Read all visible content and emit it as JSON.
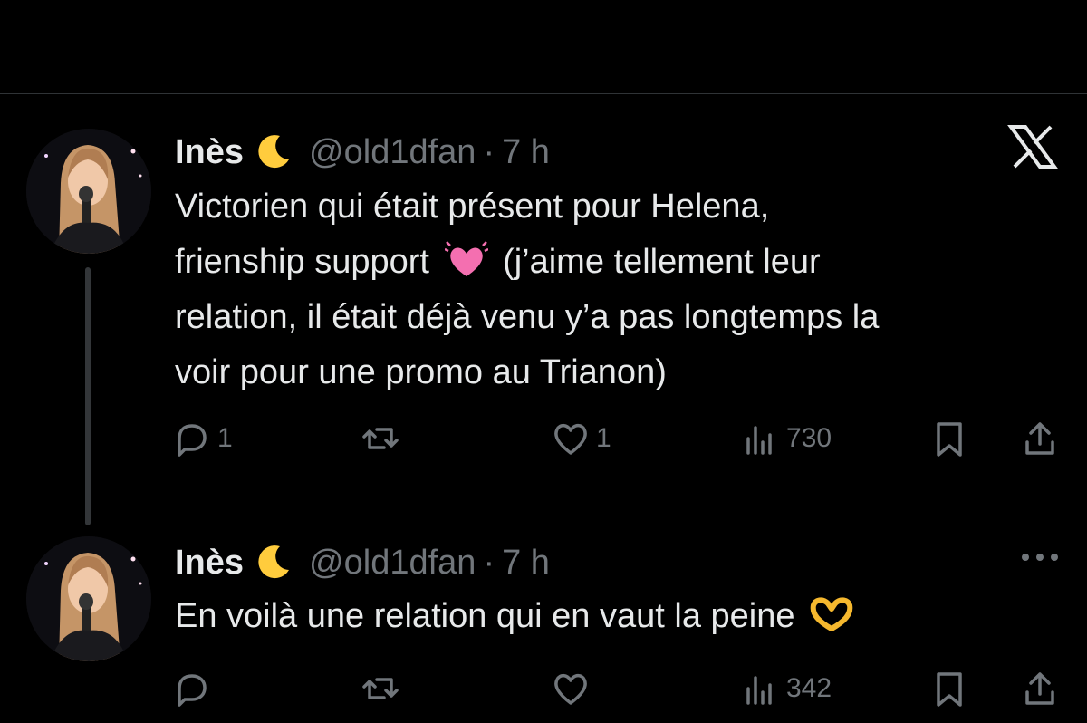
{
  "tweets": [
    {
      "name": "Inès",
      "name_emoji": "moon-emoji",
      "handle": "@old1dfan",
      "separator": "·",
      "time": "7 h",
      "text_lines": [
        "Victorien qui était présent pour Helena,",
        [
          "friendship_pre",
          "friendship_post"
        ],
        "relation, il était déjà venu y’a pas longtemps la",
        "voir pour une promo au Trianon)"
      ],
      "line1": "Victorien qui était présent pour Helena,",
      "line2_pre": "frienship support",
      "line2_post": "(j’aime tellement leur",
      "line3": "relation, il était déjà venu y’a pas longtemps la",
      "line4": "voir pour une promo au Trianon)",
      "emoji": "pink-heart-emoji",
      "replies": "1",
      "reposts": "",
      "likes": "1",
      "views": "730",
      "corner_icon": "x-logo-icon"
    },
    {
      "name": "Inès",
      "name_emoji": "moon-emoji",
      "handle": "@old1dfan",
      "separator": "·",
      "time": "7 h",
      "line1_pre": "En voilà une relation qui en vaut la peine",
      "emoji": "heart-hands-emoji",
      "replies": "",
      "reposts": "",
      "likes": "",
      "views": "342",
      "corner_icon": "more-options-icon"
    }
  ],
  "colors": {
    "background": "#000000",
    "text": "#e7e9ea",
    "secondary": "#71767b",
    "divider": "#2f3336",
    "heart": "#f46fb0"
  }
}
